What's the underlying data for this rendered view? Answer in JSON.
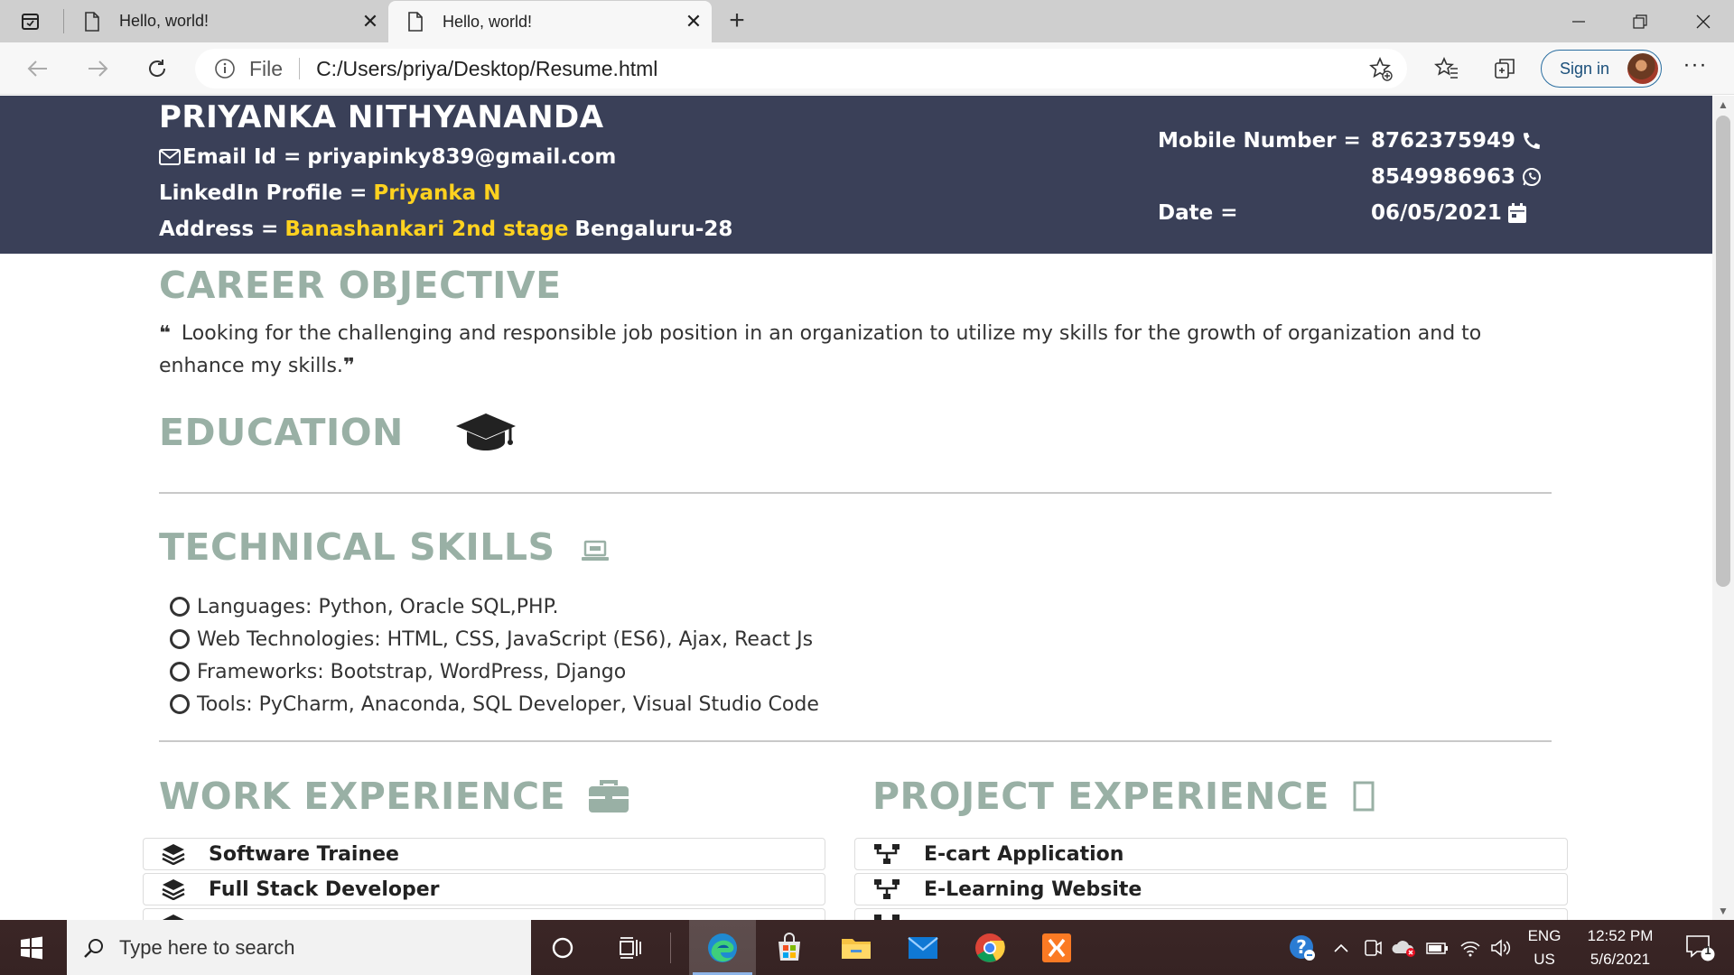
{
  "browser": {
    "tabs": [
      {
        "title": "Hello, world!",
        "active": false
      },
      {
        "title": "Hello, world!",
        "active": true
      }
    ],
    "new_tab_label": "+",
    "address": {
      "scheme_label": "File",
      "url": "C:/Users/priya/Desktop/Resume.html"
    },
    "sign_in_label": "Sign in",
    "more_label": "···"
  },
  "resume": {
    "name": "PRIYANKA NITHYANANDA",
    "email_label": "Email Id =",
    "email": "priyapinky839@gmail.com",
    "linkedin_label": "LinkedIn Profile =",
    "linkedin_value": "Priyanka N",
    "address_label": "Address =",
    "address_highlight": "Banashankari 2nd stage",
    "address_rest": "Bengaluru-28",
    "mobile_label": "Mobile Number =",
    "mobile_1": "8762375949",
    "mobile_2": "8549986963",
    "date_label": "Date =",
    "date_value": "06/05/2021",
    "career_title": "CAREER OBJECTIVE",
    "career_text": "Looking for the challenging and responsible job position in an organization to utilize my skills for the growth of organization and to enhance my skills.",
    "education_title": "EDUCATION",
    "skills_title": "TECHNICAL SKILLS",
    "skills": [
      "Languages: Python, Oracle SQL,PHP.",
      "Web Technologies: HTML, CSS, JavaScript (ES6), Ajax, React Js",
      "Frameworks: Bootstrap, WordPress, Django",
      "Tools: PyCharm, Anaconda, SQL Developer, Visual Studio Code"
    ],
    "work_title": "WORK EXPERIENCE",
    "work_items": [
      "Software Trainee",
      "Full Stack Developer"
    ],
    "project_title": "PROJECT EXPERIENCE",
    "project_items": [
      "E-cart Application",
      "E-Learning Website"
    ]
  },
  "taskbar": {
    "search_placeholder": "Type here to search",
    "language": "ENG",
    "region": "US",
    "time": "12:52 PM",
    "date": "5/6/2021",
    "notification_count": "1"
  },
  "colors": {
    "header_bg": "#3a4058",
    "highlight_yellow": "#ffd21f",
    "section_title": "#99b0a5"
  }
}
